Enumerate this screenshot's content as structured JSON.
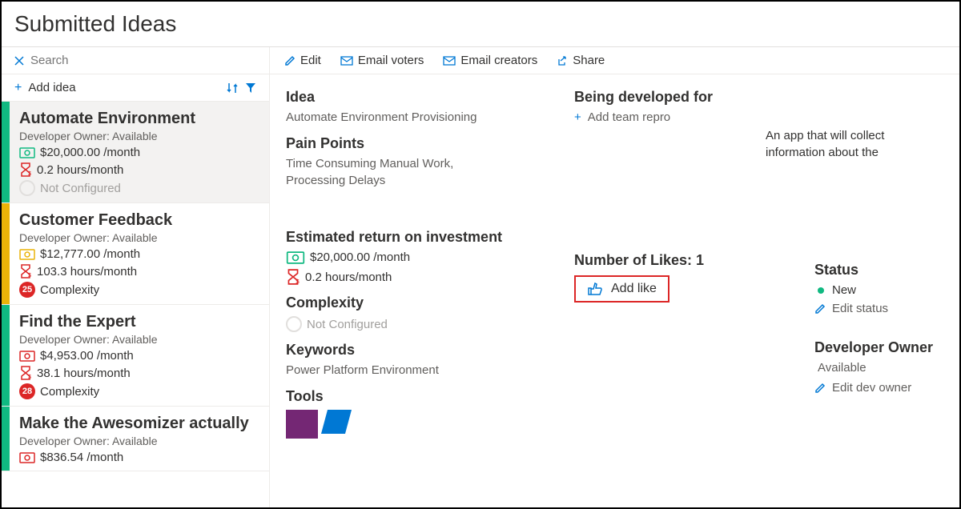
{
  "header": {
    "title": "Submitted Ideas"
  },
  "sidebar": {
    "search_placeholder": "Search",
    "add_idea_label": "Add idea",
    "items": [
      {
        "title": "Automate Environment",
        "owner": "Developer Owner: Available",
        "cost": "$20,000.00 /month",
        "hours": "0.2 hours/month",
        "complexity": "Not Configured",
        "bar": "green",
        "money_color": "green",
        "selected": true,
        "has_complexity_value": false
      },
      {
        "title": "Customer Feedback",
        "owner": "Developer Owner: Available",
        "cost": "$12,777.00 /month",
        "hours": "103.3 hours/month",
        "complexity": "Complexity",
        "complexity_value": "25",
        "bar": "yellow",
        "money_color": "yellow",
        "selected": false,
        "has_complexity_value": true
      },
      {
        "title": "Find the Expert",
        "owner": "Developer Owner: Available",
        "cost": "$4,953.00 /month",
        "hours": "38.1 hours/month",
        "complexity": "Complexity",
        "complexity_value": "28",
        "bar": "green",
        "money_color": "red",
        "selected": false,
        "has_complexity_value": true
      },
      {
        "title": "Make the Awesomizer actually",
        "owner": "Developer Owner: Available",
        "cost": "$836.54 /month",
        "bar": "green",
        "money_color": "red",
        "selected": false
      }
    ]
  },
  "toolbar": {
    "edit": "Edit",
    "email_voters": "Email voters",
    "email_creators": "Email creators",
    "share": "Share"
  },
  "detail": {
    "idea_label": "Idea",
    "idea_value": "Automate Environment Provisioning",
    "pain_label": "Pain Points",
    "pain_value": "Time Consuming Manual Work, Processing Delays",
    "roi_label": "Estimated return on investment",
    "roi_cost": "$20,000.00 /month",
    "roi_hours": "0.2 hours/month",
    "complexity_label": "Complexity",
    "complexity_value": "Not Configured",
    "keywords_label": "Keywords",
    "keywords_value": "Power Platform Environment",
    "tools_label": "Tools",
    "developed_label": "Being developed for",
    "add_team_label": "Add team repro",
    "likes_label": "Number of Likes: 1",
    "add_like_label": "Add like",
    "description": "An app that will collect information about the",
    "status_label": "Status",
    "status_value": "New",
    "edit_status": "Edit status",
    "dev_owner_label": "Developer Owner",
    "dev_owner_value": "Available",
    "edit_dev_owner": "Edit dev owner"
  }
}
